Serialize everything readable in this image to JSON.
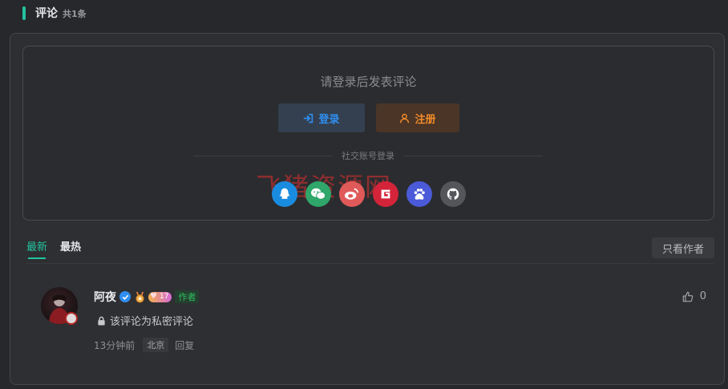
{
  "header": {
    "title": "评论",
    "count": "共1条"
  },
  "login": {
    "prompt": "请登录后发表评论",
    "login_label": "登录",
    "register_label": "注册",
    "social_label": "社交账号登录",
    "watermark": "飞猪资源网",
    "social_icons": [
      "qq-icon",
      "wechat-icon",
      "weibo-icon",
      "gitee-icon",
      "baidu-icon",
      "github-icon"
    ]
  },
  "tabs": [
    {
      "label": "最新",
      "active": true
    },
    {
      "label": "最热",
      "active": false
    }
  ],
  "only_author_label": "只看作者",
  "comment": {
    "name": "阿夜",
    "level": "17",
    "author_tag": "作者",
    "text": "该评论为私密评论",
    "time": "13分钟前",
    "location": "北京",
    "reply_label": "回复",
    "likes": "0"
  },
  "colors": {
    "accent": "#22c3a0",
    "login_blue": "#2f8ef0",
    "register_orange": "#f08a2a",
    "author_green": "#2fbf5f"
  }
}
